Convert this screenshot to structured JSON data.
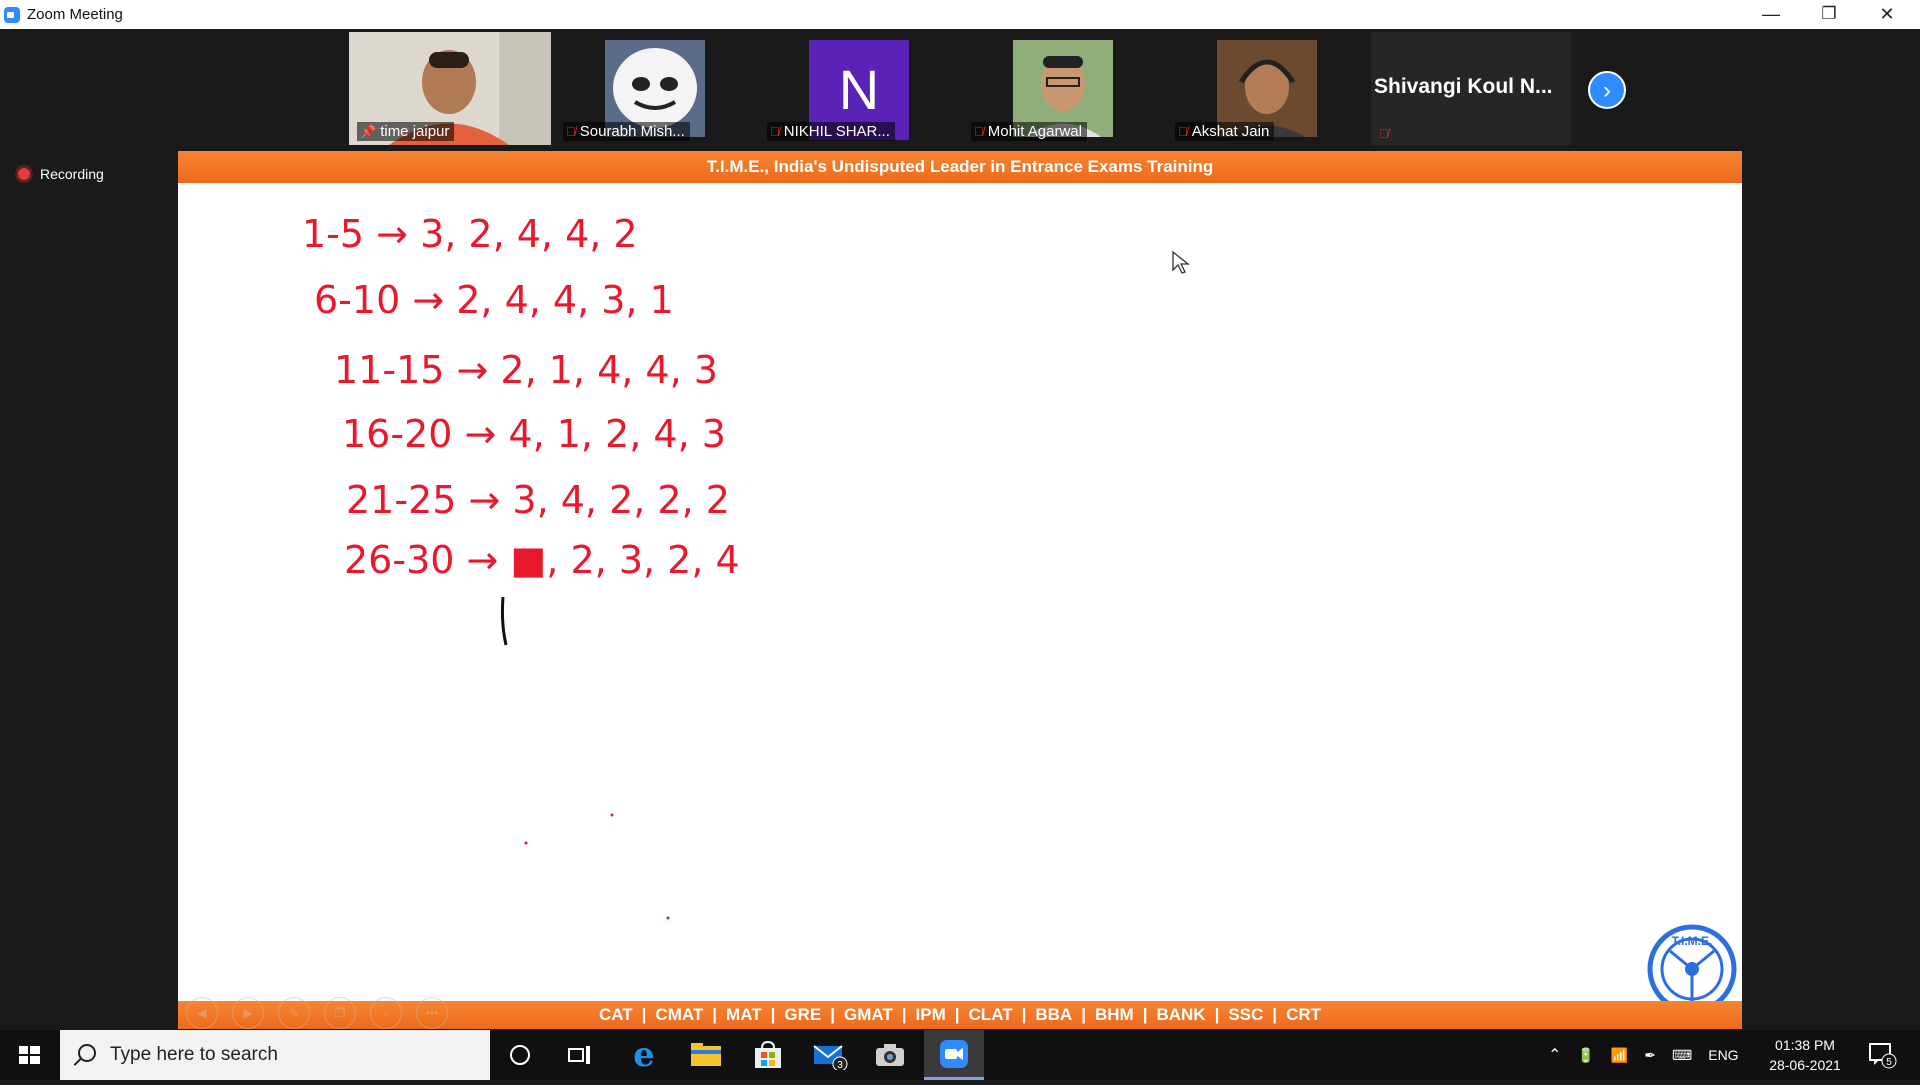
{
  "window": {
    "title": "Zoom Meeting",
    "minimize": "—",
    "restore": "❐",
    "close": "✕"
  },
  "gallery": {
    "tiles": [
      {
        "name": "time jaipur"
      },
      {
        "name": "Sourabh Mish..."
      },
      {
        "name": "NIKHIL SHAR...",
        "initial": "N"
      },
      {
        "name": "Mohit Agarwal"
      },
      {
        "name": "Akshat Jain"
      },
      {
        "name": "Shivangi Koul N..."
      }
    ],
    "next_icon": "chevron-right-icon"
  },
  "recording": {
    "label": "Recording"
  },
  "share": {
    "header": "T.I.M.E., India's Undisputed Leader in Entrance Exams Training",
    "exams": [
      "CAT",
      "CMAT",
      "MAT",
      "GRE",
      "GMAT",
      "IPM",
      "CLAT",
      "BBA",
      "BHM",
      "BANK",
      "SSC",
      "CRT"
    ],
    "notes": [
      "1-5 → 3, 2, 4, 4, 2",
      "6-10 → 2, 4, 4, 3, 1",
      "11-15 → 2, 1, 4, 4, 3",
      "16-20 → 4, 1, 2, 4, 3",
      "21-25 → 3, 4, 2, 2, 2",
      "26-30 → ■, 2, 3, 2, 4"
    ],
    "logo_text": "T.I.M.E."
  },
  "taskbar": {
    "search_placeholder": "Type here to search",
    "mail_badge": "3",
    "language": "ENG",
    "time": "01:38 PM",
    "date": "28-06-2021",
    "notifications": "5"
  }
}
